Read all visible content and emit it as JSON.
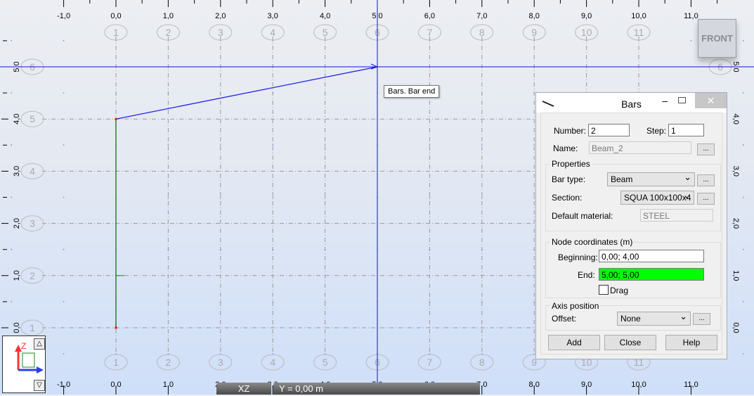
{
  "view": {
    "x_ticks": [
      "-1,0",
      "0,0",
      "1,0",
      "2,0",
      "3,0",
      "4,0",
      "5,0",
      "6,0",
      "7,0",
      "8,0",
      "9,0",
      "10,0",
      "11,0"
    ],
    "x_tick_values": [
      -1,
      0,
      1,
      2,
      3,
      4,
      5,
      6,
      7,
      8,
      9,
      10,
      11
    ],
    "z_ticks": [
      "0,0",
      "1,0",
      "2,0",
      "3,0",
      "4,0",
      "5,0"
    ],
    "column_labels": [
      "1",
      "2",
      "3",
      "4",
      "5",
      "6",
      "7",
      "8",
      "9",
      "10",
      "11"
    ],
    "row_labels": [
      "1",
      "2",
      "3",
      "4",
      "5",
      "6"
    ],
    "bars": [
      {
        "from": [
          0,
          0
        ],
        "to": [
          0,
          4
        ],
        "color": "#1a6b1a"
      },
      {
        "from": [
          0,
          4
        ],
        "to": [
          5,
          5
        ],
        "color": "#2222ee"
      }
    ],
    "cursor": [
      5,
      5
    ],
    "tooltip": "Bars. Bar end",
    "view_button": "FRONT",
    "plane": "XZ",
    "level": "Y = 0,00 m",
    "axis_z": "Z",
    "axis_x": "X"
  },
  "dialog": {
    "title": "Bars",
    "close": "✕",
    "minimize": "–",
    "number_label": "Number:",
    "number": "2",
    "step_label": "Step:",
    "step": "1",
    "name_label": "Name:",
    "name": "Beam_2",
    "more": "...",
    "properties": "Properties",
    "bar_type_label": "Bar type:",
    "bar_type": "Beam",
    "section_label": "Section:",
    "section": "SQUA 100x100x4",
    "material_label": "Default material:",
    "material": "STEEL",
    "node_coords": "Node coordinates (m)",
    "beginning_label": "Beginning:",
    "beginning": "0,00; 4,00",
    "end_label": "End:",
    "end": "5,00; 5,00",
    "end_highlight": "#00ff00",
    "drag_label": "Drag",
    "drag_checked": false,
    "axis_position": "Axis position",
    "offset_label": "Offset:",
    "offset": "None",
    "add": "Add",
    "close_btn": "Close",
    "help": "Help"
  }
}
